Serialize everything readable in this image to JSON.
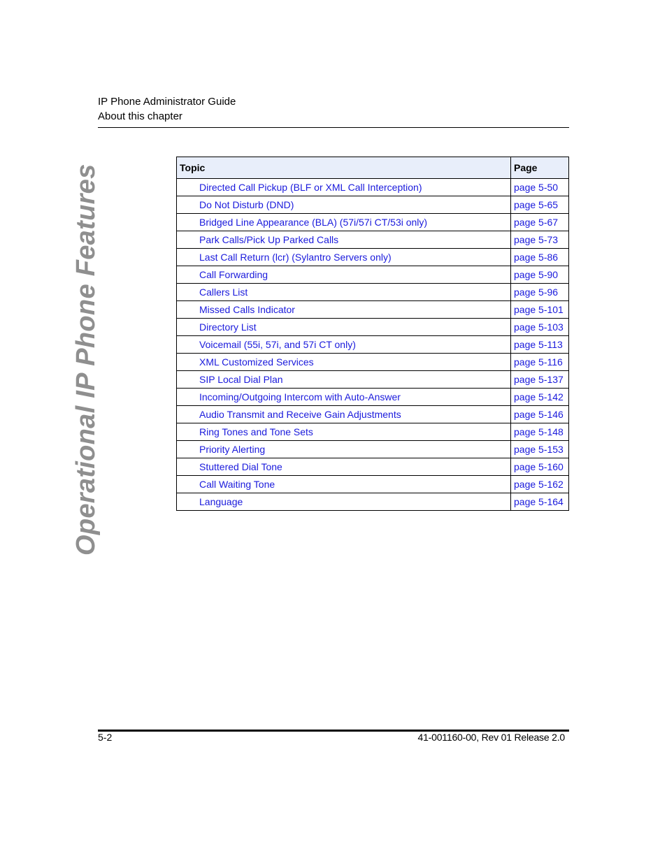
{
  "header": {
    "line1": "IP Phone Administrator Guide",
    "line2": "About this chapter"
  },
  "side_title": "Operational IP Phone Features",
  "toc": {
    "columns": [
      "Topic",
      "Page"
    ],
    "rows": [
      {
        "topic": "Directed Call Pickup (BLF or XML Call Interception)",
        "page": "page 5-50"
      },
      {
        "topic": "Do Not Disturb (DND)",
        "page": "page 5-65"
      },
      {
        "topic": "Bridged Line Appearance (BLA) (57i/57i CT/53i only)",
        "page": "page 5-67"
      },
      {
        "topic": "Park Calls/Pick Up Parked Calls",
        "page": "page 5-73"
      },
      {
        "topic": "Last Call Return (lcr) (Sylantro Servers only)",
        "page": "page 5-86"
      },
      {
        "topic": "Call Forwarding",
        "page": "page 5-90"
      },
      {
        "topic": "Callers List",
        "page": "page 5-96"
      },
      {
        "topic": "Missed Calls Indicator",
        "page": "page 5-101"
      },
      {
        "topic": "Directory List",
        "page": "page 5-103"
      },
      {
        "topic": "Voicemail (55i, 57i, and 57i CT only)",
        "page": "page 5-113"
      },
      {
        "topic": "XML Customized Services",
        "page": "page 5-116"
      },
      {
        "topic": "SIP Local Dial Plan",
        "page": "page 5-137"
      },
      {
        "topic": "Incoming/Outgoing Intercom with Auto-Answer",
        "page": "page 5-142"
      },
      {
        "topic": "Audio Transmit and Receive Gain Adjustments",
        "page": "page 5-146"
      },
      {
        "topic": "Ring Tones and Tone Sets",
        "page": "page 5-148"
      },
      {
        "topic": "Priority Alerting",
        "page": "page 5-153"
      },
      {
        "topic": "Stuttered Dial Tone",
        "page": "page 5-160"
      },
      {
        "topic": "Call Waiting Tone",
        "page": "page 5-162"
      },
      {
        "topic": "Language",
        "page": "page 5-164"
      }
    ]
  },
  "footer": {
    "page_number": "5-2",
    "doc_id": "41-001160-00, Rev 01  Release 2.0"
  },
  "colors": {
    "link": "#1a1adc",
    "header_fill": "#e8eefa",
    "side_title": "#8f8f8f"
  }
}
